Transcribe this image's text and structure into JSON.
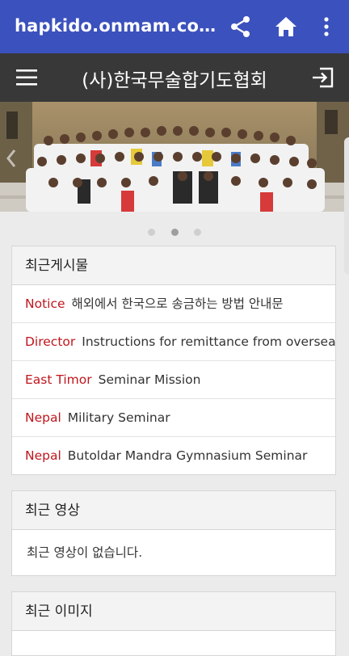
{
  "appbar": {
    "title": "hapkido.onmam.co…",
    "bg_color": "#3b51bd",
    "actions": [
      "share-icon",
      "home-icon",
      "more-vert-icon"
    ]
  },
  "sitebar": {
    "title": "(사)한국무술합기도협회",
    "bg_color": "#383838",
    "menu_icon": "hamburger-menu-icon",
    "login_icon": "login-icon"
  },
  "banner": {
    "dots": 3,
    "active_dot": 1
  },
  "recent_posts": {
    "heading": "최근게시물",
    "items": [
      {
        "category": "Notice",
        "title": "해외에서 한국으로 송금하는 방법 안내문"
      },
      {
        "category": "Director",
        "title": "Instructions for remittance from overseas to K⋯"
      },
      {
        "category": "East Timor",
        "title": "Seminar Mission"
      },
      {
        "category": "Nepal",
        "title": "Military Seminar"
      },
      {
        "category": "Nepal",
        "title": "Butoldar Mandra Gymnasium Seminar"
      }
    ]
  },
  "recent_videos": {
    "heading": "최근 영상",
    "empty_text": "최근 영상이 없습니다."
  },
  "recent_images": {
    "heading": "최근 이미지"
  },
  "colors": {
    "category_red": "#c0161d",
    "page_bg": "#ebebeb"
  }
}
